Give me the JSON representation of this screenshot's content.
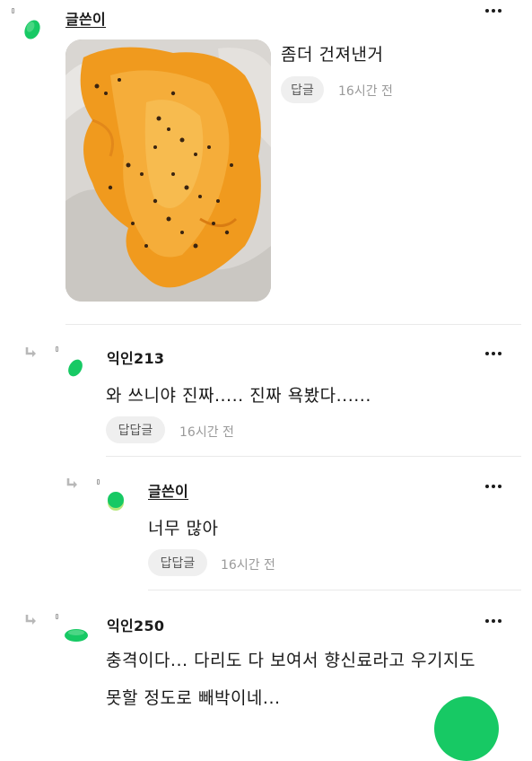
{
  "colors": {
    "avatar_green": "#17c964",
    "avatar_light": "#b6e77a",
    "reply_bg": "#efefef"
  },
  "comments": [
    {
      "name": "글쓴이",
      "text": "좀더 건져낸거",
      "reply_label": "답글",
      "time": "16시간 전",
      "has_image": true,
      "image_description_icon": "photo-icon"
    },
    {
      "name": "익인213",
      "text": "와 쓰니야 진짜..... 진짜 욕봤다......",
      "reply_label": "답답글",
      "time": "16시간 전"
    },
    {
      "name": "글쓴이",
      "text": "너무 많아",
      "reply_label": "답답글",
      "time": "16시간 전"
    },
    {
      "name": "익인250",
      "text_line1": "충격이다... 다리도 다 보여서 향신료라고 우기지도",
      "text_line2": "못할 정도로 빼박이네..."
    }
  ]
}
